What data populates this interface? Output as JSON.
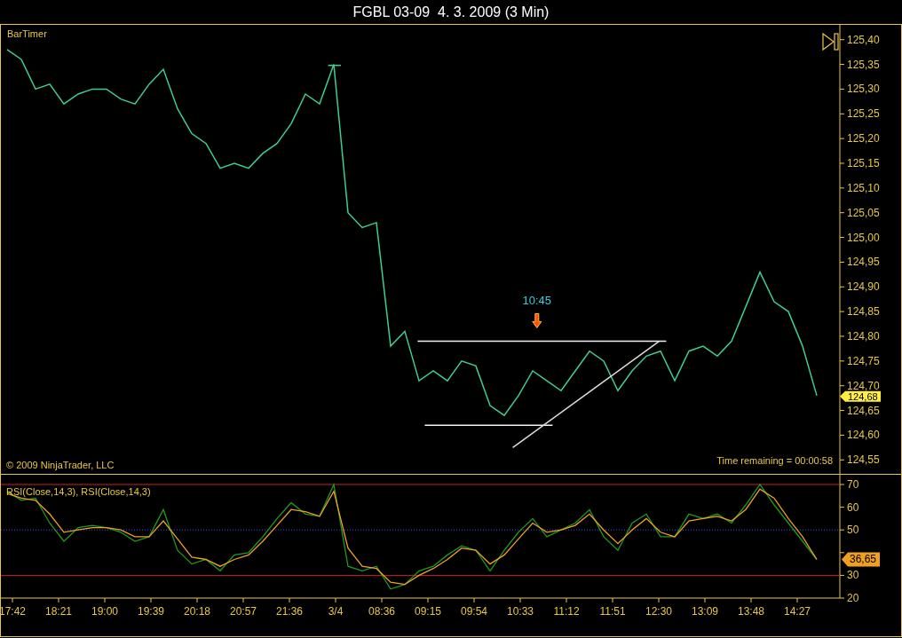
{
  "window": {
    "title": "FGBL 03-09  4. 3. 2009 (3 Min)"
  },
  "price_panel": {
    "indicator_label": "BarTimer",
    "copyright": "© 2009 NinjaTrader, LLC",
    "timer_text": "Time remaining = 00:00:58",
    "last_value_tag": "124,68",
    "chart_data": {
      "type": "line",
      "ylim": [
        124.52,
        125.43
      ],
      "series": [
        {
          "color": "#3ccf8e",
          "values": [
            125.38,
            125.36,
            125.3,
            125.31,
            125.27,
            125.29,
            125.3,
            125.3,
            125.28,
            125.27,
            125.31,
            125.34,
            125.26,
            125.21,
            125.19,
            125.14,
            125.15,
            125.14,
            125.17,
            125.19,
            125.23,
            125.29,
            125.27,
            125.35,
            125.05,
            125.02,
            125.03,
            124.78,
            124.81,
            124.71,
            124.73,
            124.71,
            124.75,
            124.74,
            124.66,
            124.64,
            124.68,
            124.73,
            124.71,
            124.69,
            124.73,
            124.77,
            124.75,
            124.69,
            124.73,
            124.76,
            124.77,
            124.71,
            124.77,
            124.78,
            124.76,
            124.79,
            124.86,
            124.93,
            124.87,
            124.85,
            124.78,
            124.68
          ]
        }
      ],
      "yticks": [
        {
          "value": 125.4,
          "label": "125,40"
        },
        {
          "value": 125.35,
          "label": "125,35"
        },
        {
          "value": 125.3,
          "label": "125,30"
        },
        {
          "value": 125.25,
          "label": "125,25"
        },
        {
          "value": 125.2,
          "label": "125,20"
        },
        {
          "value": 125.15,
          "label": "125,15"
        },
        {
          "value": 125.1,
          "label": "125,10"
        },
        {
          "value": 125.05,
          "label": "125,05"
        },
        {
          "value": 125.0,
          "label": "125,00"
        },
        {
          "value": 124.95,
          "label": "124,95"
        },
        {
          "value": 124.9,
          "label": "124,90"
        },
        {
          "value": 124.85,
          "label": "124,85"
        },
        {
          "value": 124.8,
          "label": "124,80"
        },
        {
          "value": 124.75,
          "label": "124,75"
        },
        {
          "value": 124.7,
          "label": "124,70"
        },
        {
          "value": 124.65,
          "label": "124,65"
        },
        {
          "value": 124.6,
          "label": "124,60"
        },
        {
          "value": 124.55,
          "label": "124,55"
        }
      ],
      "annotations": [
        {
          "text": "10:45"
        }
      ]
    }
  },
  "rsi_panel": {
    "legend": "RSI(Close,14,3), RSI(Close,14,3)",
    "last_value_tag": "36,65",
    "chart_data": {
      "type": "line",
      "ylim": [
        20,
        70
      ],
      "series": [
        {
          "color": "#1e9a1e",
          "values": [
            67,
            63,
            64,
            53,
            45,
            51,
            52,
            51,
            49,
            45,
            47,
            59,
            41,
            35,
            37,
            32,
            39,
            40,
            47,
            55,
            62,
            57,
            56,
            70,
            34,
            32,
            34,
            24,
            26,
            32,
            34,
            39,
            43,
            41,
            32,
            41,
            49,
            55,
            47,
            50,
            53,
            59,
            47,
            41,
            53,
            57,
            47,
            47,
            57,
            55,
            57,
            53,
            61,
            70,
            61,
            53,
            45,
            37
          ]
        },
        {
          "color": "#f0a020",
          "values": [
            66,
            64,
            63,
            57,
            49,
            50,
            51,
            51,
            50,
            47,
            47,
            54,
            46,
            38,
            37,
            34,
            37,
            39,
            45,
            52,
            59,
            58,
            56,
            67,
            42,
            34,
            33,
            27,
            26,
            30,
            33,
            37,
            42,
            41,
            35,
            39,
            46,
            53,
            49,
            50,
            52,
            57,
            50,
            44,
            50,
            55,
            49,
            47,
            54,
            55,
            56,
            54,
            59,
            68,
            64,
            55,
            47,
            37
          ]
        }
      ],
      "yticks": [
        20,
        30,
        50,
        60,
        70
      ]
    },
    "time_axis": [
      "17:42",
      "18:21",
      "19:00",
      "19:39",
      "20:18",
      "20:57",
      "21:36",
      "3/4",
      "08:36",
      "09:15",
      "09:54",
      "10:33",
      "11:12",
      "11:51",
      "12:30",
      "13:09",
      "13:48",
      "14:27"
    ]
  }
}
